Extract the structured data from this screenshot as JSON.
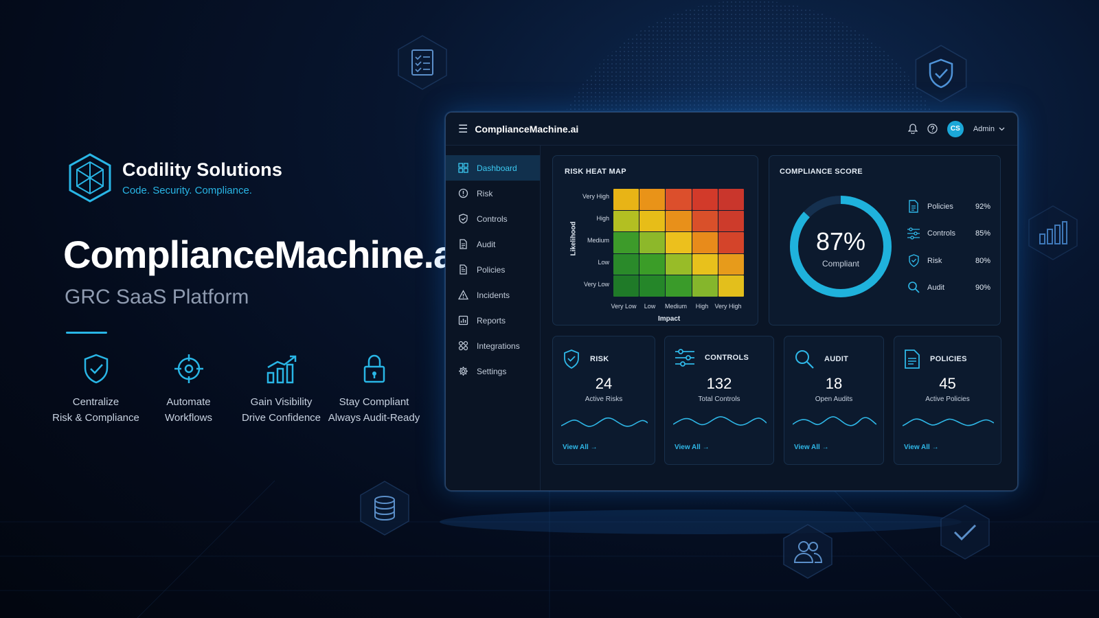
{
  "brand": {
    "name": "Codility Solutions",
    "tagline": "Code. Security. Compliance."
  },
  "hero": {
    "title": "ComplianceMachine.ai",
    "subtitle": "GRC SaaS Platform"
  },
  "features": [
    {
      "icon": "shield-check-icon",
      "line1": "Centralize",
      "line2": "Risk & Compliance"
    },
    {
      "icon": "target-icon",
      "line1": "Automate",
      "line2": "Workflows"
    },
    {
      "icon": "growth-chart-icon",
      "line1": "Gain Visibility",
      "line2": "Drive Confidence"
    },
    {
      "icon": "lock-icon",
      "line1": "Stay Compliant",
      "line2": "Always Audit-Ready"
    }
  ],
  "app": {
    "title": "ComplianceMachine.ai",
    "avatar_initials": "CS",
    "user_label": "Admin"
  },
  "sidebar": {
    "items": [
      {
        "label": "Dashboard",
        "icon": "grid-icon",
        "active": true
      },
      {
        "label": "Risk",
        "icon": "warning-icon"
      },
      {
        "label": "Controls",
        "icon": "shield-icon"
      },
      {
        "label": "Audit",
        "icon": "document-icon"
      },
      {
        "label": "Policies",
        "icon": "policy-icon"
      },
      {
        "label": "Incidents",
        "icon": "alert-triangle-icon"
      },
      {
        "label": "Reports",
        "icon": "report-chart-icon"
      },
      {
        "label": "Integrations",
        "icon": "integrations-icon"
      },
      {
        "label": "Settings",
        "icon": "gear-icon"
      }
    ]
  },
  "heatmap": {
    "title": "RISK HEAT MAP",
    "y_title": "Likelihood",
    "x_title": "Impact",
    "y_labels": [
      "Very High",
      "High",
      "Medium",
      "Low",
      "Very Low"
    ],
    "x_labels": [
      "Very Low",
      "Low",
      "Medium",
      "High",
      "Very High"
    ],
    "cell_colors": [
      [
        "#e8b416",
        "#e99318",
        "#dc4f2c",
        "#d23a2a",
        "#c9362c"
      ],
      [
        "#b3bf22",
        "#e7bd18",
        "#e8901a",
        "#d9502a",
        "#cd3b2b"
      ],
      [
        "#3d9b2a",
        "#8db82a",
        "#ecc01d",
        "#e88b1b",
        "#d4442a"
      ],
      [
        "#2a8a2a",
        "#3b9d28",
        "#98bc28",
        "#e8c11c",
        "#e79b1b"
      ],
      [
        "#1f7a28",
        "#258629",
        "#3a9b2a",
        "#85b62c",
        "#e3bf1c"
      ]
    ]
  },
  "compliance": {
    "title": "COMPLIANCE SCORE",
    "value": "87%",
    "fraction": 0.87,
    "label": "Compliant",
    "metrics": [
      {
        "label": "Policies",
        "value": "92%",
        "icon": "document-icon"
      },
      {
        "label": "Controls",
        "value": "85%",
        "icon": "sliders-icon"
      },
      {
        "label": "Risk",
        "value": "80%",
        "icon": "shield-check-icon"
      },
      {
        "label": "Audit",
        "value": "90%",
        "icon": "search-icon"
      }
    ]
  },
  "stats": [
    {
      "title": "RISK",
      "value": "24",
      "label": "Active Risks",
      "link": "View All →",
      "icon": "shield-check-icon"
    },
    {
      "title": "CONTROLS",
      "value": "132",
      "label": "Total Controls",
      "link": "View All →",
      "icon": "sliders-icon"
    },
    {
      "title": "AUDIT",
      "value": "18",
      "label": "Open Audits",
      "link": "View All →",
      "icon": "search-icon"
    },
    {
      "title": "POLICIES",
      "value": "45",
      "label": "Active Policies",
      "link": "View All →",
      "icon": "document-icon"
    }
  ],
  "colors": {
    "accent": "#29b6e6",
    "active_nav": "#3ccaf2",
    "gauge": "#1fb2dc"
  }
}
